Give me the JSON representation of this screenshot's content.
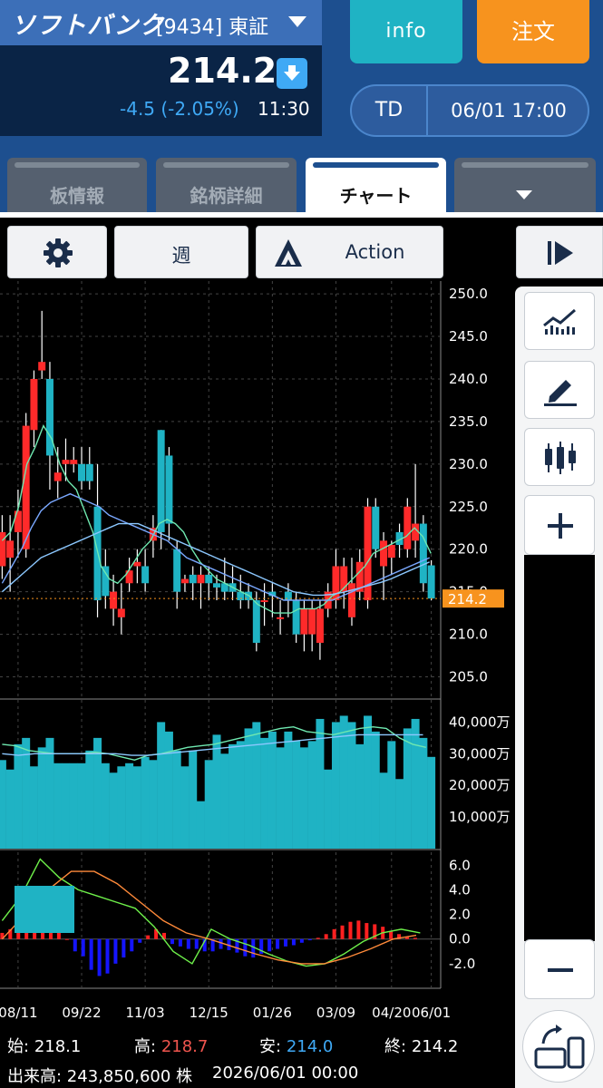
{
  "stock": {
    "name": "ソフトバンク",
    "code": "[9434] 東証",
    "price": "214.2",
    "change": "-4.5 (-2.05%)",
    "time": "11:30"
  },
  "header_buttons": {
    "info": "info",
    "order": "注文"
  },
  "td": {
    "label": "TD",
    "date": "06/01 17:00"
  },
  "tabs": [
    {
      "label": "板情報",
      "active": false
    },
    {
      "label": "銘柄詳細",
      "active": false
    },
    {
      "label": "チャート",
      "active": true
    },
    {
      "label": "",
      "active": false
    }
  ],
  "toolbar": {
    "period": "週",
    "action": "Action"
  },
  "footer": {
    "open_label": "始:",
    "open": "218.1",
    "high_label": "高:",
    "high": "218.7",
    "low_label": "安:",
    "low": "214.0",
    "close_label": "終:",
    "close": "214.2",
    "volume": "出来高: 243,850,600 株",
    "datetime": "2026/06/01 00:00"
  },
  "colors": {
    "up": "#ff2a2a",
    "down": "#1fb3c4",
    "ma1": "#6fe8b0",
    "ma2": "#7aa8ff",
    "ma3": "#8cc8ff",
    "current": "#f7931e"
  },
  "icons": [
    "gear-icon",
    "action-triangle-icon",
    "play-panel-icon",
    "indicator-chart-icon",
    "pencil-icon",
    "candlestick-icon",
    "zoom-in-icon",
    "zoom-out-icon",
    "rotate-screen-icon",
    "price-down-arrow-icon",
    "dropdown-icon"
  ],
  "chart_data": [
    {
      "type": "candlestick",
      "x_tick_labels": [
        "08/11",
        "09/22",
        "11/03",
        "12/15",
        "01/26",
        "03/09",
        "04/20",
        "06/01"
      ],
      "y_ticks": [
        205.0,
        210.0,
        215.0,
        220.0,
        225.0,
        230.0,
        235.0,
        240.0,
        245.0,
        250.0
      ],
      "ylim": [
        202.5,
        251.5
      ],
      "current_price": 214.2,
      "candles": [
        {
          "o": 218,
          "h": 224,
          "l": 216.5,
          "c": 222
        },
        {
          "o": 219,
          "h": 224,
          "l": 215,
          "c": 221
        },
        {
          "o": 222,
          "h": 227,
          "l": 219,
          "c": 224.5
        },
        {
          "o": 220,
          "h": 236,
          "l": 219,
          "c": 234.5
        },
        {
          "o": 234,
          "h": 241,
          "l": 232,
          "c": 240
        },
        {
          "o": 241,
          "h": 248,
          "l": 240,
          "c": 242
        },
        {
          "o": 240,
          "h": 242,
          "l": 227,
          "c": 231
        },
        {
          "o": 228,
          "h": 232,
          "l": 226,
          "c": 229
        },
        {
          "o": 230,
          "h": 233,
          "l": 228,
          "c": 230.5
        },
        {
          "o": 230,
          "h": 232,
          "l": 229,
          "c": 230.5
        },
        {
          "o": 230,
          "h": 232,
          "l": 227,
          "c": 228
        },
        {
          "o": 230,
          "h": 232,
          "l": 227,
          "c": 228
        },
        {
          "o": 225,
          "h": 230,
          "l": 212,
          "c": 214
        },
        {
          "o": 218,
          "h": 220,
          "l": 213,
          "c": 214.5
        },
        {
          "o": 213,
          "h": 217,
          "l": 211,
          "c": 215
        },
        {
          "o": 212,
          "h": 216,
          "l": 210,
          "c": 213
        },
        {
          "o": 216,
          "h": 219,
          "l": 215,
          "c": 217.5
        },
        {
          "o": 218,
          "h": 220,
          "l": 216,
          "c": 218.5
        },
        {
          "o": 218,
          "h": 220,
          "l": 215,
          "c": 216
        },
        {
          "o": 221,
          "h": 224,
          "l": 219,
          "c": 222.5
        },
        {
          "o": 234,
          "h": 234,
          "l": 220,
          "c": 222
        },
        {
          "o": 231,
          "h": 232,
          "l": 221,
          "c": 223
        },
        {
          "o": 220,
          "h": 221,
          "l": 213,
          "c": 215
        },
        {
          "o": 216,
          "h": 217,
          "l": 215,
          "c": 216.5
        },
        {
          "o": 217,
          "h": 218,
          "l": 214,
          "c": 216
        },
        {
          "o": 216,
          "h": 218,
          "l": 213,
          "c": 217
        },
        {
          "o": 217,
          "h": 218,
          "l": 214,
          "c": 216
        },
        {
          "o": 216,
          "h": 217,
          "l": 214,
          "c": 215.5
        },
        {
          "o": 216,
          "h": 219,
          "l": 214,
          "c": 215
        },
        {
          "o": 216,
          "h": 218,
          "l": 214,
          "c": 215
        },
        {
          "o": 215,
          "h": 217,
          "l": 213,
          "c": 214
        },
        {
          "o": 215,
          "h": 216,
          "l": 213,
          "c": 214
        },
        {
          "o": 214,
          "h": 215,
          "l": 208,
          "c": 209
        },
        {
          "o": 214,
          "h": 216,
          "l": 211,
          "c": 214
        },
        {
          "o": 215,
          "h": 216,
          "l": 212,
          "c": 214.5
        },
        {
          "o": 212,
          "h": 214,
          "l": 210,
          "c": 212
        },
        {
          "o": 215,
          "h": 216,
          "l": 212,
          "c": 214
        },
        {
          "o": 214,
          "h": 215,
          "l": 209,
          "c": 210
        },
        {
          "o": 210,
          "h": 214,
          "l": 208,
          "c": 213
        },
        {
          "o": 210,
          "h": 214,
          "l": 208,
          "c": 213
        },
        {
          "o": 209,
          "h": 214,
          "l": 207,
          "c": 213
        },
        {
          "o": 213,
          "h": 216,
          "l": 212,
          "c": 215
        },
        {
          "o": 214,
          "h": 220,
          "l": 213,
          "c": 218
        },
        {
          "o": 215,
          "h": 219,
          "l": 213,
          "c": 218
        },
        {
          "o": 212,
          "h": 219,
          "l": 211,
          "c": 216
        },
        {
          "o": 215,
          "h": 220,
          "l": 214,
          "c": 218.5
        },
        {
          "o": 214,
          "h": 226,
          "l": 213,
          "c": 225
        },
        {
          "o": 225,
          "h": 226,
          "l": 219,
          "c": 220
        },
        {
          "o": 218,
          "h": 222,
          "l": 214,
          "c": 221
        },
        {
          "o": 219,
          "h": 221,
          "l": 217,
          "c": 220.5
        },
        {
          "o": 222,
          "h": 223,
          "l": 219,
          "c": 220.5
        },
        {
          "o": 220,
          "h": 226,
          "l": 219,
          "c": 225
        },
        {
          "o": 221,
          "h": 230,
          "l": 219,
          "c": 223
        },
        {
          "o": 223,
          "h": 224,
          "l": 215,
          "c": 216
        },
        {
          "o": 218.1,
          "h": 218.7,
          "l": 214,
          "c": 214.2
        }
      ],
      "ma_short_values": [
        221,
        222,
        225,
        230,
        232,
        234.5,
        233,
        230,
        228,
        227,
        224.5,
        222,
        218,
        216.5,
        216,
        217,
        218.5,
        220,
        221,
        223,
        223.5,
        223,
        222,
        220,
        218.5,
        217.5,
        216.5,
        216,
        215.5,
        215,
        214.5,
        213.5,
        213,
        212.5,
        212.5,
        212.5,
        213,
        213,
        213,
        213.5,
        214.5,
        215,
        216,
        217,
        218,
        219.5,
        220,
        220.5,
        221,
        221.5,
        222.5,
        221.5,
        219.5
      ],
      "ma_mid_values": [
        216,
        218,
        220,
        222.5,
        224.5,
        225.5,
        226,
        226.5,
        226,
        225.5,
        225,
        224,
        223.5,
        223,
        222.5,
        222,
        221.5,
        221,
        220,
        219,
        218.5,
        218,
        217.5,
        217,
        216.5,
        216,
        215.5,
        215,
        214.5,
        214,
        214,
        214,
        214,
        214,
        214,
        214.5,
        215,
        215.5,
        216,
        216.5,
        217,
        217.5,
        218,
        218.5,
        219
      ],
      "ma_long_values": [
        215,
        216,
        217,
        218,
        219,
        219.5,
        220,
        220.5,
        221,
        221.5,
        222,
        222.5,
        223,
        223,
        223,
        222.5,
        222,
        221.5,
        221,
        220.5,
        220,
        219.5,
        219,
        218.5,
        218,
        217.5,
        217,
        216.5,
        216,
        215.5,
        215,
        214.8,
        214.6,
        214.6,
        214.7,
        214.9,
        215.2,
        215.5,
        215.8,
        216.1,
        216.5,
        217,
        217.5,
        218,
        218.5
      ],
      "volume_ticks": [
        "40,000万",
        "30,000万",
        "20,000万",
        "10,000万"
      ],
      "volume_ylim": [
        0,
        47000
      ],
      "volume_values": [
        28000,
        25000,
        33000,
        35000,
        26000,
        32000,
        35000,
        27000,
        27000,
        27000,
        27000,
        31000,
        35000,
        27000,
        24000,
        26000,
        27000,
        26000,
        29000,
        28000,
        40000,
        37000,
        31000,
        26000,
        31000,
        15000,
        28000,
        36000,
        30000,
        33000,
        34000,
        38000,
        40000,
        35000,
        37000,
        32000,
        37000,
        34000,
        32000,
        34000,
        41000,
        25000,
        40000,
        42000,
        40000,
        33000,
        42000,
        37000,
        24000,
        34000,
        22000,
        38000,
        41000,
        35000,
        29000
      ],
      "volume_ma_short": [
        33000,
        32500,
        31000,
        30500,
        30000,
        30000,
        30000,
        30500,
        30000,
        29000,
        28000,
        29500,
        30000,
        31000,
        32000,
        32500,
        33000,
        34000,
        35000,
        36000,
        37000,
        38000,
        38500,
        37000,
        36500,
        36000,
        37000,
        38000,
        38500,
        38000,
        35000,
        33000,
        32000
      ],
      "volume_ma_long": [
        30000,
        29500,
        30000,
        30000,
        30000,
        30000,
        30000,
        30000,
        29500,
        29500,
        30000,
        30500,
        31000,
        31500,
        32000,
        32500,
        33000,
        33500,
        34000,
        34500,
        35000,
        35500,
        36000,
        36000,
        36000,
        36000,
        36000
      ],
      "macd_ticks": [
        6.0,
        4.0,
        2.0,
        0.0,
        -2.0
      ],
      "macd_ylim": [
        -4,
        7.2
      ],
      "macd_line": [
        1.5,
        3.5,
        6.5,
        5.0,
        4.0,
        3.5,
        3.0,
        2.5,
        1.0,
        -1.0,
        -2.0,
        0.8,
        0.0,
        -0.5,
        -1.2,
        -1.8,
        -2.2,
        -2.0,
        -1.2,
        -0.2,
        0.5,
        0.8,
        0.5
      ],
      "signal_line": [
        0,
        2.0,
        4.0,
        5.5,
        5.5,
        4.5,
        3.0,
        1.5,
        0.5,
        0.0,
        -0.6,
        -1.2,
        -1.7,
        -2.0,
        -2.0,
        -1.5,
        -0.8,
        0.0,
        0.3
      ],
      "histogram": [
        0.5,
        0.8,
        1.5,
        2.3,
        1.5,
        0.7,
        1.0,
        0.5,
        0.0,
        -1.0,
        -1.4,
        -2.5,
        -3.0,
        -2.8,
        -2.0,
        -1.5,
        -1.0,
        -0.3,
        0.3,
        0.8,
        0.5,
        -0.4,
        -0.6,
        -0.8,
        -0.8,
        -1.0,
        -1.0,
        -0.8,
        -0.9,
        -1.1,
        -1.4,
        -1.5,
        -1.2,
        -1.0,
        -0.8,
        -0.6,
        -0.5,
        -0.3,
        -0.1,
        0.1,
        0.4,
        0.8,
        1.1,
        1.4,
        1.5,
        1.3,
        1.2,
        1.0,
        0.6,
        0.4,
        0.2,
        0.1
      ]
    }
  ]
}
